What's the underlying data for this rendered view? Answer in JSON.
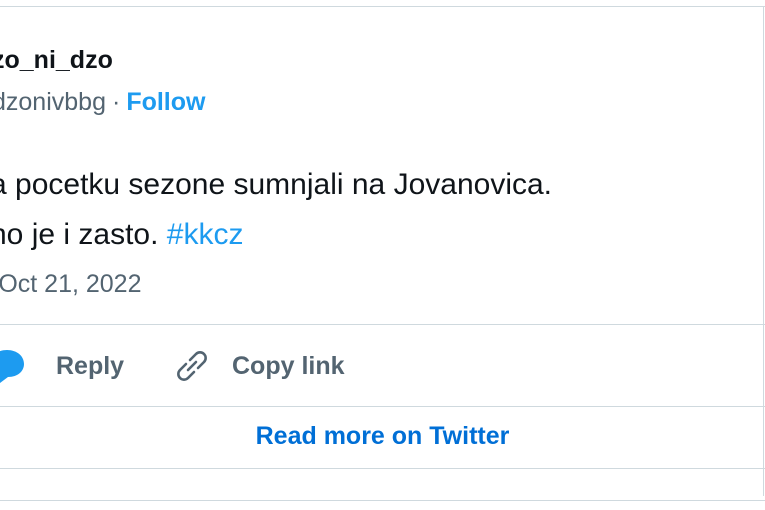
{
  "tweet": {
    "display_name": "zo_ni_dzo",
    "handle": "dzonivbbg",
    "separator": "·",
    "follow_label": "Follow",
    "text_line1": "a pocetku sezone sumnjali na Jovanovica.",
    "text_line2_prefix": "no je i zasto.",
    "hashtag": "#kkcz",
    "time_separator": "·",
    "date": "Oct 21, 2022"
  },
  "actions": {
    "reply_label": "Reply",
    "copy_link_label": "Copy link",
    "reply_icon": "speech-bubble-icon",
    "copy_link_icon": "link-icon"
  },
  "footer": {
    "read_more_label": "Read more on Twitter"
  },
  "colors": {
    "text_primary": "#0f1419",
    "text_secondary": "#536471",
    "accent": "#1d9bf0",
    "read_more": "#006fd6",
    "border": "#cfd9de"
  }
}
